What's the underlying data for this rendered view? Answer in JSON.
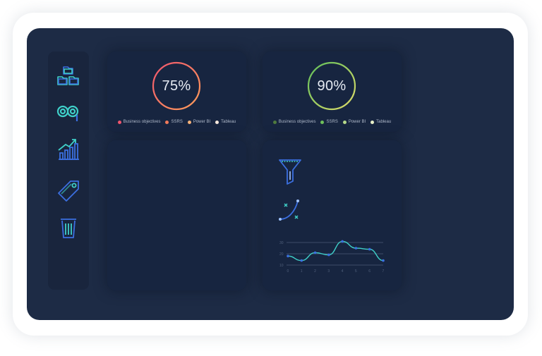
{
  "cards": [
    {
      "value_label": "75%",
      "progress": 75,
      "ring_gradient": [
        "#f0556d",
        "#ff9e5a"
      ],
      "legend": [
        {
          "label": "Business objectives",
          "color": "#f0556d"
        },
        {
          "label": "SSRS",
          "color": "#f07a5a"
        },
        {
          "label": "Power BI",
          "color": "#f5b27a"
        },
        {
          "label": "Tableau",
          "color": "#f6e8dc"
        }
      ]
    },
    {
      "value_label": "90%",
      "progress": 90,
      "ring_gradient": [
        "#5fbf5a",
        "#e0dc6a"
      ],
      "legend": [
        {
          "label": "Business objectives",
          "color": "#4f7a3d"
        },
        {
          "label": "SSRS",
          "color": "#6fbf5a"
        },
        {
          "label": "Power BI",
          "color": "#b6d98a"
        },
        {
          "label": "Tableau",
          "color": "#e8f0c8"
        }
      ]
    }
  ],
  "sidebar_icons": [
    "folders-icon",
    "binoculars-icon",
    "bar-chart-growth-icon",
    "price-tag-icon",
    "trash-bin-icon"
  ],
  "analytics_icons": [
    "funnel-icon",
    "curve-points-icon"
  ],
  "colors": {
    "screen": "#1d2b45",
    "card": "#172540",
    "accent_cyan": "#3fd0c9",
    "accent_blue": "#3b6fe0"
  },
  "chart_data": {
    "type": "line",
    "x": [
      0,
      1,
      2,
      3,
      4,
      5,
      6,
      7
    ],
    "y_ticks": [
      "10",
      "20",
      "30"
    ],
    "x_ticks": [
      "0",
      "1",
      "2",
      "3",
      "4",
      "5",
      "6",
      "7"
    ],
    "ylim": [
      10,
      30
    ],
    "series": [
      {
        "values": [
          18,
          14,
          21,
          19,
          31,
          25,
          24,
          14
        ]
      }
    ]
  }
}
